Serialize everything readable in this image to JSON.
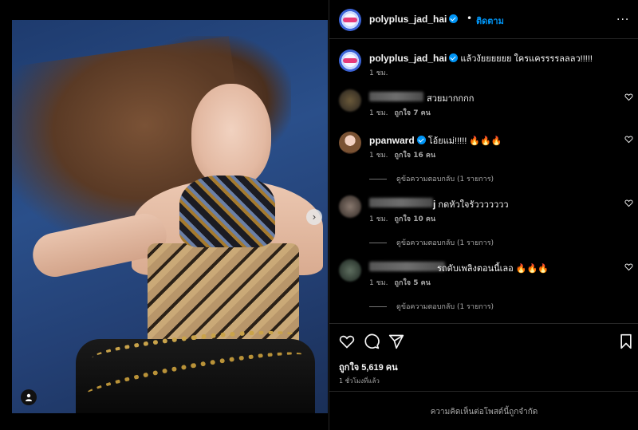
{
  "media": {
    "next_icon": "chevron-right-icon",
    "tag_icon": "user-tag-icon"
  },
  "header": {
    "username": "polyplus_jad_hai",
    "dot": "•",
    "follow_label": "ติดตาม",
    "more_label": "..."
  },
  "caption": {
    "username": "polyplus_jad_hai",
    "text": "แล้วงัยยยยยย ใครแครรรรลลลว!!!!!",
    "time": "1 ชม."
  },
  "comments": [
    {
      "username": "",
      "text": "สวยมากกกก",
      "time": "1 ชม.",
      "likes": "ถูกใจ 7 คน",
      "replies": ""
    },
    {
      "username": "ppanward",
      "text": "โอ้ยแม่!!!!! 🔥🔥🔥",
      "time": "1 ชม.",
      "likes": "ถูกใจ 16 คน",
      "replies": "ดูข้อความตอบกลับ (1 รายการ)"
    },
    {
      "username": "j",
      "text": "กดหัวใจรัววววววว",
      "time": "1 ชม.",
      "likes": "ถูกใจ 10 คน",
      "replies": "ดูข้อความตอบกลับ (1 รายการ)"
    },
    {
      "username": "",
      "text": "รถดับเพลิงตอนนี้เลอ 🔥🔥🔥",
      "time": "1 ชม.",
      "likes": "ถูกใจ 5 คน",
      "replies": "ดูข้อความตอบกลับ (1 รายการ)"
    }
  ],
  "actions": {
    "like_icon": "heart-icon",
    "comment_icon": "comment-icon",
    "share_icon": "share-icon",
    "save_icon": "bookmark-icon",
    "likes": "ถูกใจ 5,619 คน",
    "posted": "1 ชั่วโมงที่แล้ว",
    "comments_limited": "ความคิดเห็นต่อโพสต์นี้ถูกจำกัด"
  },
  "colors": {
    "accent": "#0095f6",
    "background": "#000000",
    "muted": "#a8a8a8"
  }
}
